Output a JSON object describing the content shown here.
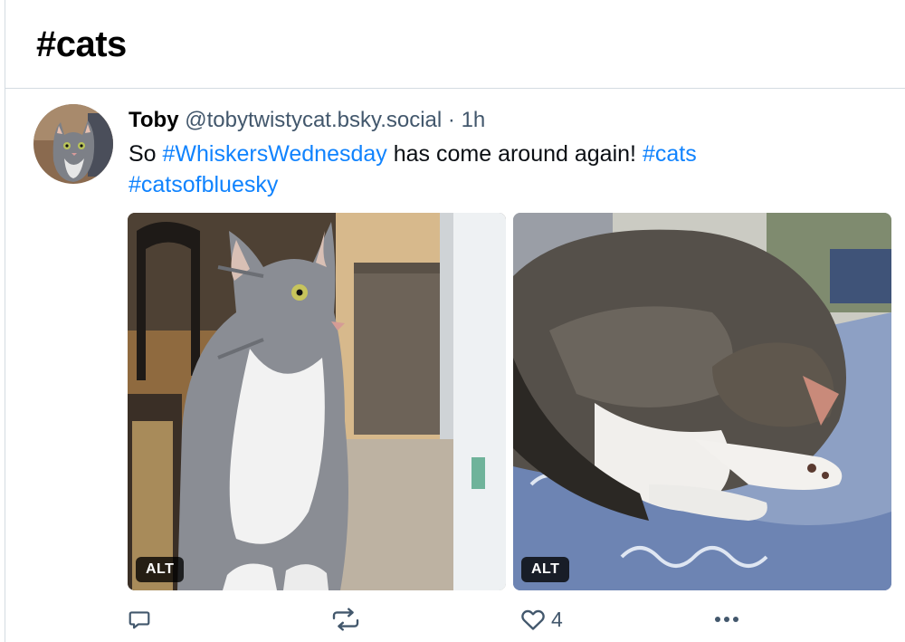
{
  "header": {
    "title": "#cats"
  },
  "post": {
    "author": "Toby",
    "handle": "@tobytwistycat.bsky.social",
    "separator": "·",
    "time": "1h",
    "text_before": "So ",
    "hashtag1": "#WhiskersWednesday",
    "text_middle": " has come around again! ",
    "hashtag2": "#cats",
    "hashtag3": "#catsofbluesky",
    "images": [
      {
        "alt_badge": "ALT"
      },
      {
        "alt_badge": "ALT"
      }
    ],
    "actions": {
      "reply_icon": "speech-bubble-icon",
      "repost_icon": "repost-icon",
      "like_icon": "heart-icon",
      "like_count": "4",
      "more_icon": "ellipsis-icon"
    }
  },
  "colors": {
    "link": "#1083fe",
    "muted": "#42576c",
    "divider": "#d4dbe2"
  }
}
